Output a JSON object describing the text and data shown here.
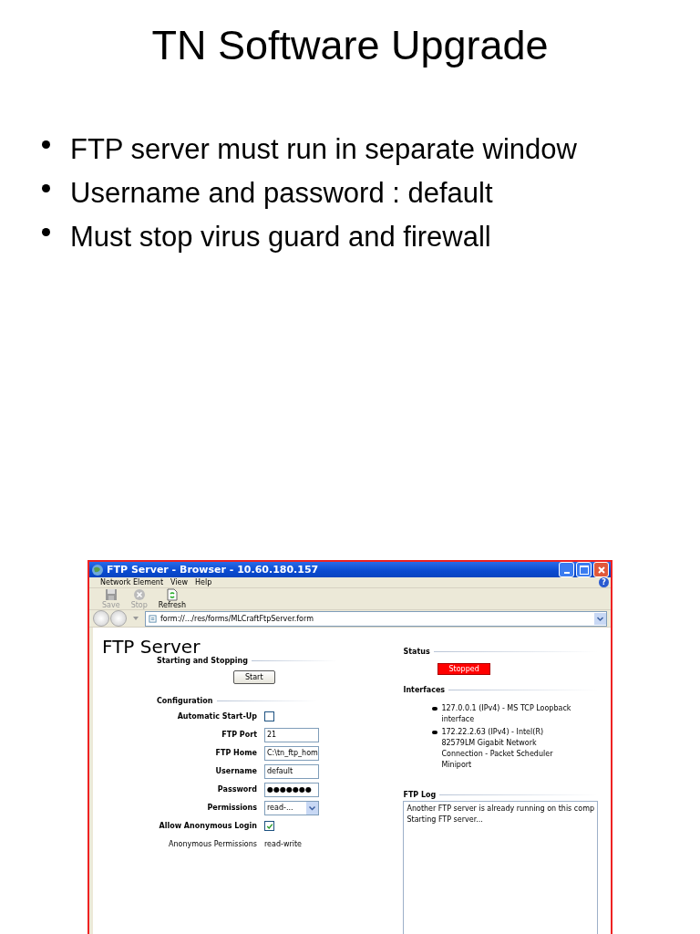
{
  "slide": {
    "title": "TN Software Upgrade",
    "bullets": [
      "FTP server must run in separate window",
      "Username and password : default",
      "Must stop virus guard and firewall"
    ]
  },
  "window": {
    "title": "FTP Server - Browser - 10.60.180.157",
    "menu": [
      "Network Element",
      "View",
      "Help"
    ],
    "help_button": "?",
    "toolbar": [
      {
        "label": "Save",
        "disabled": true
      },
      {
        "label": "Stop",
        "disabled": true
      },
      {
        "label": "Refresh",
        "disabled": false
      }
    ],
    "address": "form://.../res/forms/MLCraftFtpServer.form",
    "form": {
      "heading": "FTP Server",
      "start_section": "Starting and Stopping",
      "start_button": "Start",
      "config_section": "Configuration",
      "fields": [
        {
          "kind": "checkbox",
          "label": "Automatic Start-Up",
          "checked": false
        },
        {
          "kind": "text",
          "label": "FTP Port",
          "value": "21"
        },
        {
          "kind": "text",
          "label": "FTP Home",
          "value": "C:\\tn_ftp_hom"
        },
        {
          "kind": "text",
          "label": "Username",
          "value": "default"
        },
        {
          "kind": "text",
          "label": "Password",
          "value": "●●●●●●●"
        },
        {
          "kind": "select",
          "label": "Permissions",
          "value": "read-..."
        },
        {
          "kind": "checkbox",
          "label": "Allow Anonymous Login",
          "checked": true
        },
        {
          "kind": "readonly",
          "label": "Anonymous Permissions",
          "value": "read-write"
        }
      ],
      "status_section": "Status",
      "status": "Stopped",
      "interfaces_section": "Interfaces",
      "interfaces": [
        "127.0.0.1 (IPv4) - MS TCP Loopback interface",
        "172.22.2.63 (IPv4) - Intel(R) 82579LM Gigabit Network Connection - Packet Scheduler Miniport"
      ],
      "log_section": "FTP Log",
      "log": [
        "Another FTP server is already running on this comp",
        "Starting FTP server..."
      ]
    }
  }
}
